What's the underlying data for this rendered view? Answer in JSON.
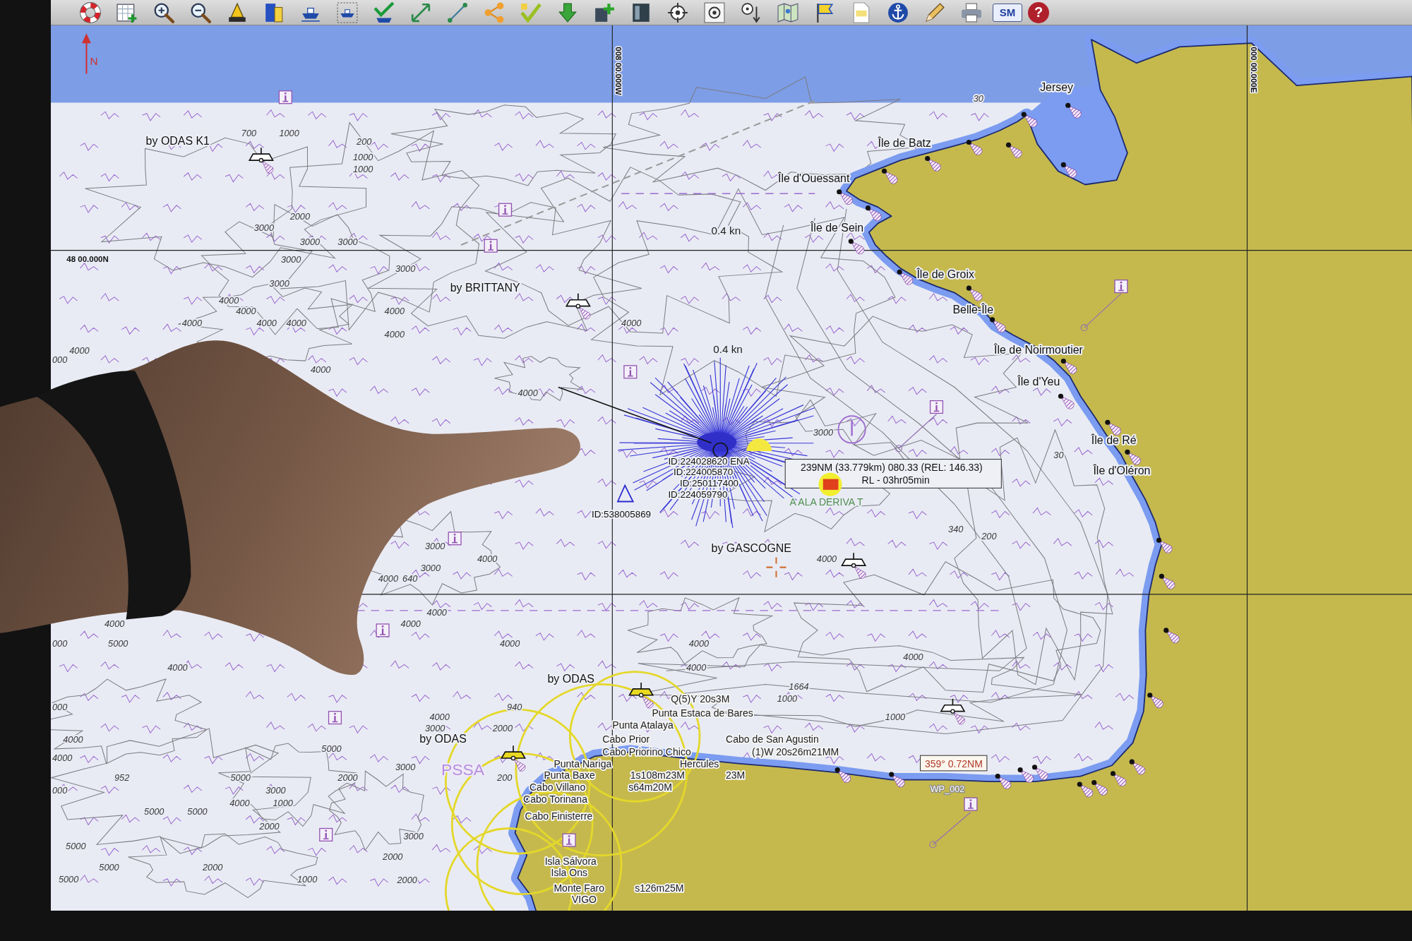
{
  "toolbar": {
    "buttons": [
      {
        "kind": "lifebuoy"
      },
      {
        "kind": "grid_add"
      },
      {
        "kind": "zoom_in"
      },
      {
        "kind": "zoom_out"
      },
      {
        "kind": "bell"
      },
      {
        "kind": "layers"
      },
      {
        "kind": "ship"
      },
      {
        "kind": "ship_box"
      },
      {
        "kind": "ship_check"
      },
      {
        "kind": "expand"
      },
      {
        "kind": "line"
      },
      {
        "kind": "share"
      },
      {
        "kind": "check"
      },
      {
        "kind": "download"
      },
      {
        "kind": "add"
      },
      {
        "kind": "panel"
      },
      {
        "kind": "target"
      },
      {
        "kind": "target_box"
      },
      {
        "kind": "target_arrow"
      },
      {
        "kind": "map"
      },
      {
        "kind": "flag"
      },
      {
        "kind": "note"
      },
      {
        "kind": "anchor"
      },
      {
        "kind": "pencil"
      },
      {
        "kind": "printer"
      },
      {
        "kind": "badge",
        "label": "SM"
      },
      {
        "kind": "help",
        "label": "?"
      }
    ]
  },
  "chart": {
    "north_arrow": {
      "label": "N"
    },
    "grid_labels": [
      {
        "kind": "longitude",
        "text": "008 00.000W"
      },
      {
        "kind": "longitude",
        "text": "000 00.000E"
      },
      {
        "kind": "latitude",
        "text": "48 00.000N"
      }
    ],
    "place_labels": [
      "Jersey",
      "by ODAS K1",
      "Île de Batz",
      "Île d'Ouessant",
      "Île de Sein",
      "Île de Groix",
      "by BRITTANY",
      "Belle-Île",
      "Île de Noirmoutier",
      "Île d'Yeu",
      "Île de Ré",
      "Île d'Oléron",
      "by GASCOGNE",
      "by ODAS",
      "by ODAS"
    ],
    "current_labels": [
      "0.4 kn",
      "0.4 kn"
    ],
    "vessel_ids": [
      "ID:224028620 ENA",
      "ID:224005870",
      "ID:250117400",
      "ID:224059790",
      "ID:538005869"
    ],
    "measurement": {
      "line_1": "239NM (33.779km) 080.33 (REL: 146.33)",
      "line_2": "RL - 03hr05min"
    },
    "target_label": "A ALA DERIVA T",
    "light_labels": [
      "Q(5)Y 20s3M",
      "Punta Estaca de Bares",
      "Punta Atalaya",
      "Cabo Prior",
      "Cabo de San Agustin",
      "Cabo Priorino Chico",
      "(1)W 20s26m21MM",
      "Punta Nariga",
      "Hercules",
      "Punta Baxe",
      "1s108m23M",
      "23M",
      "Cabo Villano",
      "s64m20M",
      "Cabo Torinana",
      "Cabo Finisterre",
      "Isla Sálvora",
      "Isla Ons",
      "Monte Faro",
      "s126m25M",
      "VIGO"
    ],
    "area_label": "PSSA",
    "bearing_label": "359° 0.72NM",
    "waypoint_label": "WP_002",
    "soundings": [
      "30",
      "700",
      "1000",
      "200",
      "1000",
      "1000",
      "2000",
      "3000",
      "3000",
      "3000",
      "3000",
      "3000",
      "3000",
      "4000",
      "4000",
      "4000",
      "4000",
      "4000",
      "4000",
      "4000",
      "4000",
      "4000",
      "000",
      "4000",
      "4000",
      "3000",
      "30",
      "340",
      "200",
      "3000",
      "4000",
      "4000",
      "3000",
      "4000",
      "640",
      "4000",
      "4000",
      "4000",
      "000",
      "5000",
      "4000",
      "4000",
      "4000",
      "4000",
      "4000",
      "1664",
      "1000",
      "000",
      "940",
      "4000",
      "1000",
      "3000",
      "2000",
      "4000",
      "5000",
      "4000",
      "3000",
      "952",
      "5000",
      "2000",
      "200",
      "000",
      "3000",
      "4000",
      "1000",
      "5000",
      "5000",
      "2000",
      "3000",
      "5000",
      "2000",
      "5000",
      "2000",
      "5000",
      "1000",
      "2000"
    ]
  }
}
